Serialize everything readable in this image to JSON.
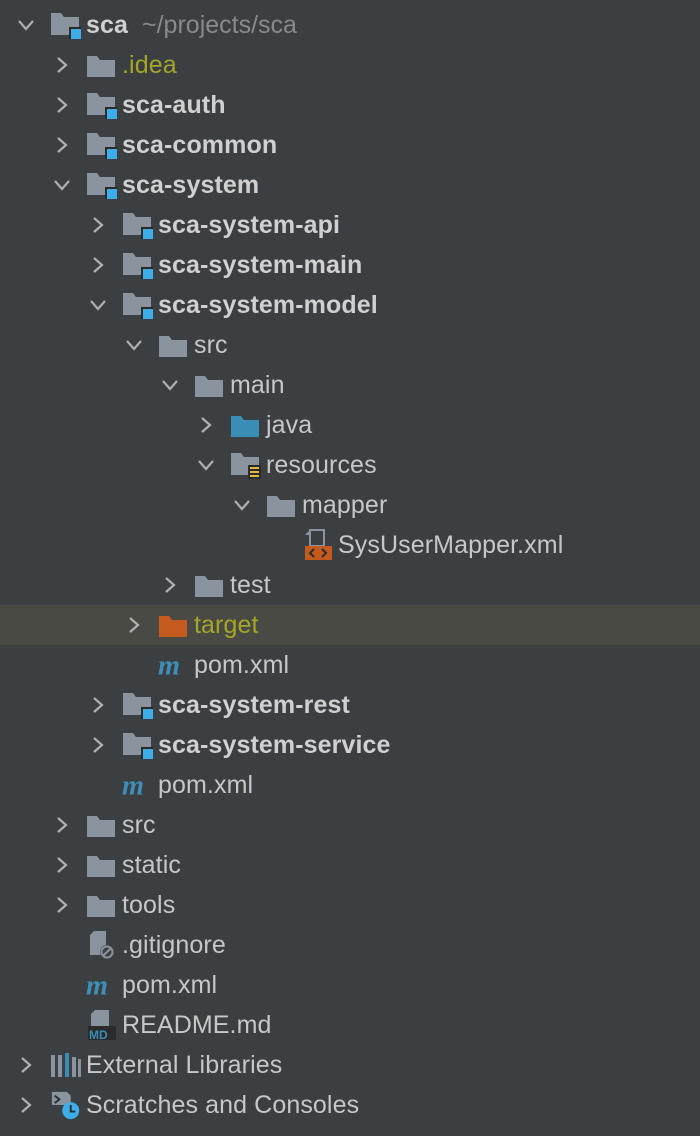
{
  "project": {
    "name": "sca",
    "path": "~/projects/sca"
  },
  "rows": [
    {
      "label": "sca",
      "hint": "~/projects/sca",
      "level": 0,
      "arrow": "down",
      "icon": "module",
      "style": "bold"
    },
    {
      "label": ".idea",
      "level": 1,
      "arrow": "right",
      "icon": "folder",
      "style": "olive"
    },
    {
      "label": "sca-auth",
      "level": 1,
      "arrow": "right",
      "icon": "module",
      "style": "bold"
    },
    {
      "label": "sca-common",
      "level": 1,
      "arrow": "right",
      "icon": "module",
      "style": "bold"
    },
    {
      "label": "sca-system",
      "level": 1,
      "arrow": "down",
      "icon": "module",
      "style": "bold"
    },
    {
      "label": "sca-system-api",
      "level": 2,
      "arrow": "right",
      "icon": "module",
      "style": "bold"
    },
    {
      "label": "sca-system-main",
      "level": 2,
      "arrow": "right",
      "icon": "module",
      "style": "bold"
    },
    {
      "label": "sca-system-model",
      "level": 2,
      "arrow": "down",
      "icon": "module",
      "style": "bold"
    },
    {
      "label": "src",
      "level": 3,
      "arrow": "down",
      "icon": "folder",
      "style": "normal"
    },
    {
      "label": "main",
      "level": 4,
      "arrow": "down",
      "icon": "folder",
      "style": "normal"
    },
    {
      "label": "java",
      "level": 5,
      "arrow": "right",
      "icon": "folder-source",
      "style": "normal"
    },
    {
      "label": "resources",
      "level": 5,
      "arrow": "down",
      "icon": "folder-resources",
      "style": "normal"
    },
    {
      "label": "mapper",
      "level": 6,
      "arrow": "down",
      "icon": "folder",
      "style": "normal"
    },
    {
      "label": "SysUserMapper.xml",
      "level": 7,
      "arrow": "none",
      "icon": "xml-file",
      "style": "normal"
    },
    {
      "label": "test",
      "level": 4,
      "arrow": "right",
      "icon": "folder",
      "style": "normal"
    },
    {
      "label": "target",
      "level": 3,
      "arrow": "right",
      "icon": "folder-excluded",
      "style": "olive",
      "selected": true
    },
    {
      "label": "pom.xml",
      "level": 3,
      "arrow": "none",
      "icon": "maven",
      "style": "normal"
    },
    {
      "label": "sca-system-rest",
      "level": 2,
      "arrow": "right",
      "icon": "module",
      "style": "bold"
    },
    {
      "label": "sca-system-service",
      "level": 2,
      "arrow": "right",
      "icon": "module",
      "style": "bold"
    },
    {
      "label": "pom.xml",
      "level": 2,
      "arrow": "none",
      "icon": "maven",
      "style": "normal"
    },
    {
      "label": "src",
      "level": 1,
      "arrow": "right",
      "icon": "folder",
      "style": "normal"
    },
    {
      "label": "static",
      "level": 1,
      "arrow": "right",
      "icon": "folder",
      "style": "normal"
    },
    {
      "label": "tools",
      "level": 1,
      "arrow": "right",
      "icon": "folder",
      "style": "normal"
    },
    {
      "label": ".gitignore",
      "level": 1,
      "arrow": "none",
      "icon": "ignore-file",
      "style": "normal"
    },
    {
      "label": "pom.xml",
      "level": 1,
      "arrow": "none",
      "icon": "maven",
      "style": "normal"
    },
    {
      "label": "README.md",
      "level": 1,
      "arrow": "none",
      "icon": "markdown-file",
      "style": "normal"
    },
    {
      "label": "External Libraries",
      "level": 0,
      "arrow": "right",
      "icon": "libraries",
      "style": "normal"
    },
    {
      "label": "Scratches and Consoles",
      "level": 0,
      "arrow": "right",
      "icon": "scratches",
      "style": "normal"
    }
  ],
  "colors": {
    "background": "#3c3f41",
    "selected_row": "#4a4a44",
    "folder": "#8a949e",
    "module_badge": "#3daee9",
    "source_folder": "#3a8db5",
    "excluded_folder": "#c55a1e",
    "olive_text": "#a5a628",
    "maven": "#3d8fb8"
  }
}
